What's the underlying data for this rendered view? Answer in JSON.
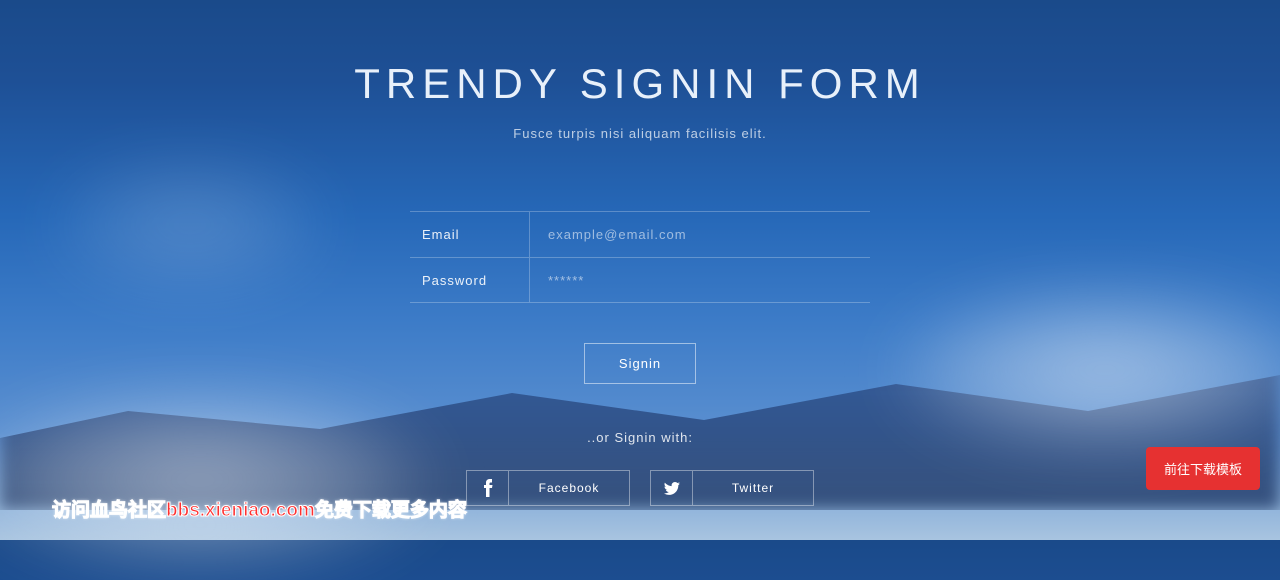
{
  "header": {
    "title": "TRENDY SIGNIN FORM",
    "subtitle": "Fusce turpis nisi aliquam facilisis elit."
  },
  "form": {
    "email_label": "Email",
    "email_placeholder": "example@email.com",
    "password_label": "Password",
    "password_placeholder": "******",
    "signin_button": "Signin"
  },
  "social": {
    "or_text": "..or Signin with:",
    "facebook_label": "Facebook",
    "twitter_label": "Twitter"
  },
  "download_button": "前往下载模板",
  "watermark": "访问血鸟社区bbs.xieniao.com免费下载更多内容"
}
